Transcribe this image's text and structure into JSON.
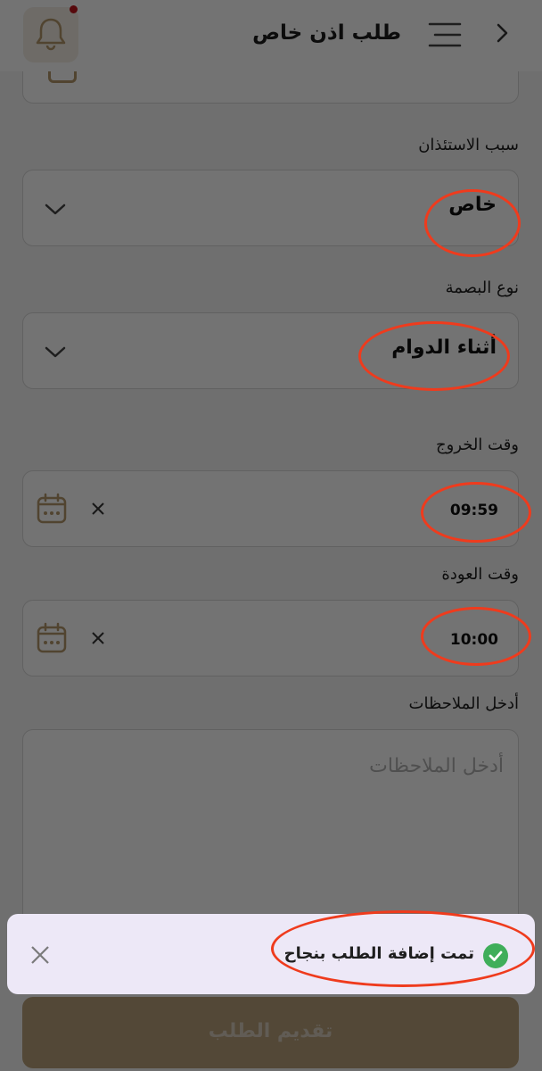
{
  "header": {
    "title": "طلب اذن خاص",
    "back_icon": "chevron-left-icon",
    "menu_icon": "hamburger-icon",
    "notification_icon": "bell-icon"
  },
  "form": {
    "reason": {
      "label": "سبب الاستئذان",
      "value": "خاص"
    },
    "fingerprint_type": {
      "label": "نوع البصمة",
      "value": "أثناء الدوام"
    },
    "exit_time": {
      "label": "وقت الخروج",
      "value": "09:59"
    },
    "return_time": {
      "label": "وقت العودة",
      "value": "10:00"
    },
    "notes": {
      "label": "أدخل الملاحظات",
      "placeholder": "أدخل الملاحظات",
      "value": ""
    },
    "submit_label": "تقديم الطلب"
  },
  "toast": {
    "message": "تمت إضافة الطلب بنجاح",
    "status": "success"
  },
  "colors": {
    "accent": "#b3986a",
    "success": "#3fae5a",
    "annotation": "#ef3b1d",
    "notification_dot": "#c0161c"
  }
}
